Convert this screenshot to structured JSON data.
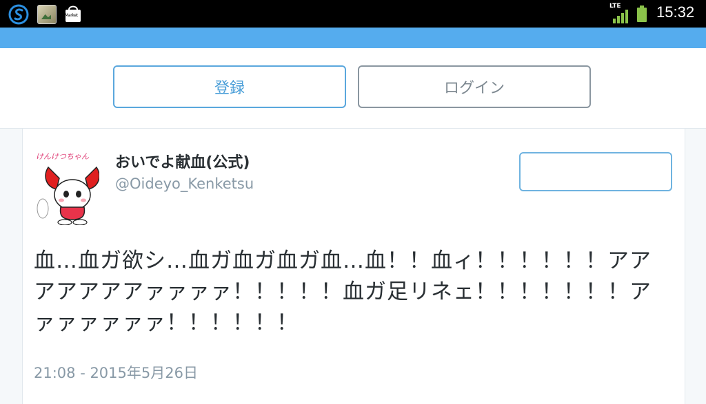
{
  "status_bar": {
    "time": "15:32",
    "network_label": "LTE",
    "market_label": "Market",
    "icons": [
      "sync-icon",
      "photo-gallery-icon",
      "market-icon",
      "signal-icon",
      "battery-icon"
    ]
  },
  "auth": {
    "signup_label": "登録",
    "login_label": "ログイン"
  },
  "tweet": {
    "display_name": "おいでよ献血(公式)",
    "screen_name": "@Oideyo_Kenketsu",
    "text": "血…血ガ欲シ…血ガ血ガ血ガ血…血！！血ィ！！！！！！アアアアアアアァァァァ！！！！！血ガ足リネェ！！！！！！！アァァァァァァ！！！！！！",
    "timestamp": "21:08 - 2015年5月26日",
    "avatar_caption": "けんけつちゃん",
    "follow_button_label": ""
  },
  "colors": {
    "twitter_blue": "#55acee",
    "text_dark": "#292f33",
    "text_muted": "#8899a6"
  }
}
